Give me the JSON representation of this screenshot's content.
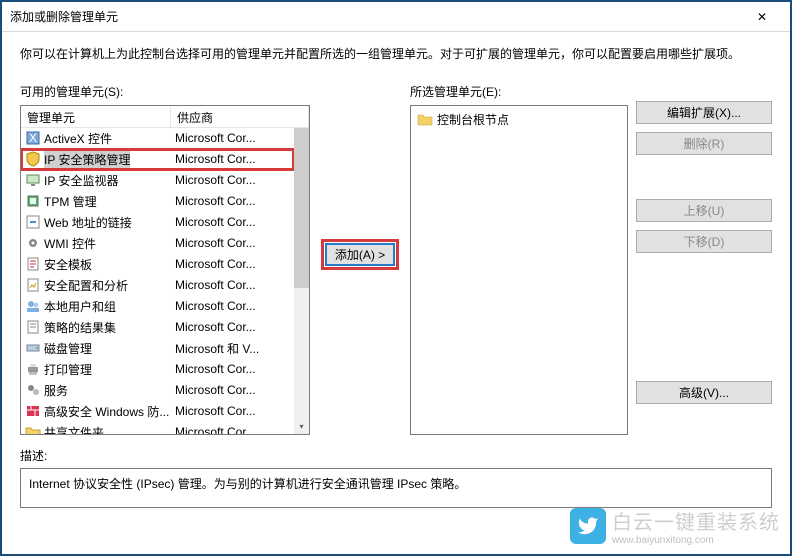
{
  "window": {
    "title": "添加或删除管理单元",
    "intro": "你可以在计算机上为此控制台选择可用的管理单元并配置所选的一组管理单元。对于可扩展的管理单元，你可以配置要启用哪些扩展项。"
  },
  "available": {
    "label": "可用的管理单元(S):",
    "columns": {
      "name": "管理单元",
      "vendor": "供应商"
    },
    "scroll_up": "▴",
    "scroll_down": "▾",
    "items": [
      {
        "icon": "activex",
        "name": "ActiveX 控件",
        "vendor": "Microsoft Cor...",
        "selected": false
      },
      {
        "icon": "shield",
        "name": "IP 安全策略管理",
        "vendor": "Microsoft Cor...",
        "selected": true
      },
      {
        "icon": "monitor",
        "name": "IP 安全监视器",
        "vendor": "Microsoft Cor...",
        "selected": false
      },
      {
        "icon": "chip",
        "name": "TPM 管理",
        "vendor": "Microsoft Cor...",
        "selected": false
      },
      {
        "icon": "link",
        "name": "Web 地址的链接",
        "vendor": "Microsoft Cor...",
        "selected": false
      },
      {
        "icon": "gear",
        "name": "WMI 控件",
        "vendor": "Microsoft Cor...",
        "selected": false
      },
      {
        "icon": "template",
        "name": "安全模板",
        "vendor": "Microsoft Cor...",
        "selected": false
      },
      {
        "icon": "analysis",
        "name": "安全配置和分析",
        "vendor": "Microsoft Cor...",
        "selected": false
      },
      {
        "icon": "users",
        "name": "本地用户和组",
        "vendor": "Microsoft Cor...",
        "selected": false
      },
      {
        "icon": "policy",
        "name": "策略的结果集",
        "vendor": "Microsoft Cor...",
        "selected": false
      },
      {
        "icon": "disk",
        "name": "磁盘管理",
        "vendor": "Microsoft 和 V...",
        "selected": false
      },
      {
        "icon": "printer",
        "name": "打印管理",
        "vendor": "Microsoft Cor...",
        "selected": false
      },
      {
        "icon": "services",
        "name": "服务",
        "vendor": "Microsoft Cor...",
        "selected": false
      },
      {
        "icon": "firewall",
        "name": "高级安全 Windows 防...",
        "vendor": "Microsoft Cor...",
        "selected": false
      },
      {
        "icon": "folder",
        "name": "共享文件夹",
        "vendor": "Microsoft Cor",
        "selected": false
      }
    ]
  },
  "add_button": {
    "label": "添加(A) >"
  },
  "selected_panel": {
    "label": "所选管理单元(E):",
    "root_label": "控制台根节点"
  },
  "right_buttons": {
    "edit_ext": "编辑扩展(X)...",
    "remove": "删除(R)",
    "move_up": "上移(U)",
    "move_down": "下移(D)",
    "advanced": "高级(V)..."
  },
  "description": {
    "label": "描述:",
    "text": "Internet 协议安全性 (IPsec) 管理。为与别的计算机进行安全通讯管理 IPsec 策略。"
  },
  "watermark": {
    "cn": "白云一键重装系统",
    "url": "www.baiyunxitong.com"
  }
}
